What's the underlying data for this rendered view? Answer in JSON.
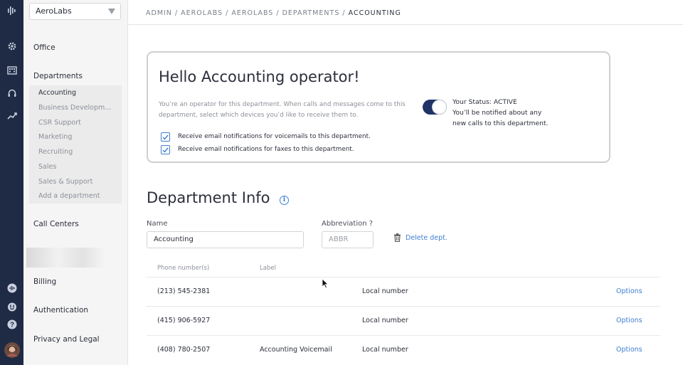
{
  "company": {
    "name": "AeroLabs"
  },
  "sidebar": {
    "office": "Office",
    "departments": "Departments",
    "department_items": [
      {
        "label": "Accounting",
        "active": true
      },
      {
        "label": "Business Developm..."
      },
      {
        "label": "CSR Support"
      },
      {
        "label": "Marketing"
      },
      {
        "label": "Recruiting"
      },
      {
        "label": "Sales"
      },
      {
        "label": "Sales & Support"
      },
      {
        "label": "Add a department"
      }
    ],
    "call_centers": "Call Centers",
    "billing": "Billing",
    "authentication": "Authentication",
    "privacy": "Privacy and Legal"
  },
  "breadcrumb": {
    "path": "ADMIN / AEROLABS / AEROLABS / DEPARTMENTS / ",
    "current": "ACCOUNTING"
  },
  "hello": {
    "title": "Hello Accounting operator!",
    "description": "You’re an operator for this department. When calls and messages come to this department, select which devices you’d like to receive them to.",
    "checkbox_voicemail": "Receive email notifications for voicemails to this department.",
    "checkbox_faxes": "Receive email notifications for faxes to this department.",
    "status_line1": "Your Status: ACTIVE",
    "status_line2": "You’ll be notified about any",
    "status_line3": "new calls to this department."
  },
  "dept_info": {
    "title": "Department Info",
    "name_label": "Name",
    "name_value": "Accounting",
    "abbr_label": "Abbreviation  ?",
    "abbr_placeholder": "ABBR",
    "delete_label": "Delete dept."
  },
  "phones": {
    "col_phone": "Phone number(s)",
    "col_label": "Label",
    "rows": [
      {
        "number": "(213) 545-2381",
        "label": "",
        "type": "Local number",
        "options": "Options"
      },
      {
        "number": "(415) 906-5927",
        "label": "",
        "type": "Local number",
        "options": "Options"
      },
      {
        "number": "(408) 780-2507",
        "label": "Accounting Voicemail",
        "type": "Local number",
        "options": "Options"
      }
    ]
  },
  "colors": {
    "rail": "#1f2a44",
    "accent": "#3e7fd0",
    "toggle": "#1f3366"
  }
}
